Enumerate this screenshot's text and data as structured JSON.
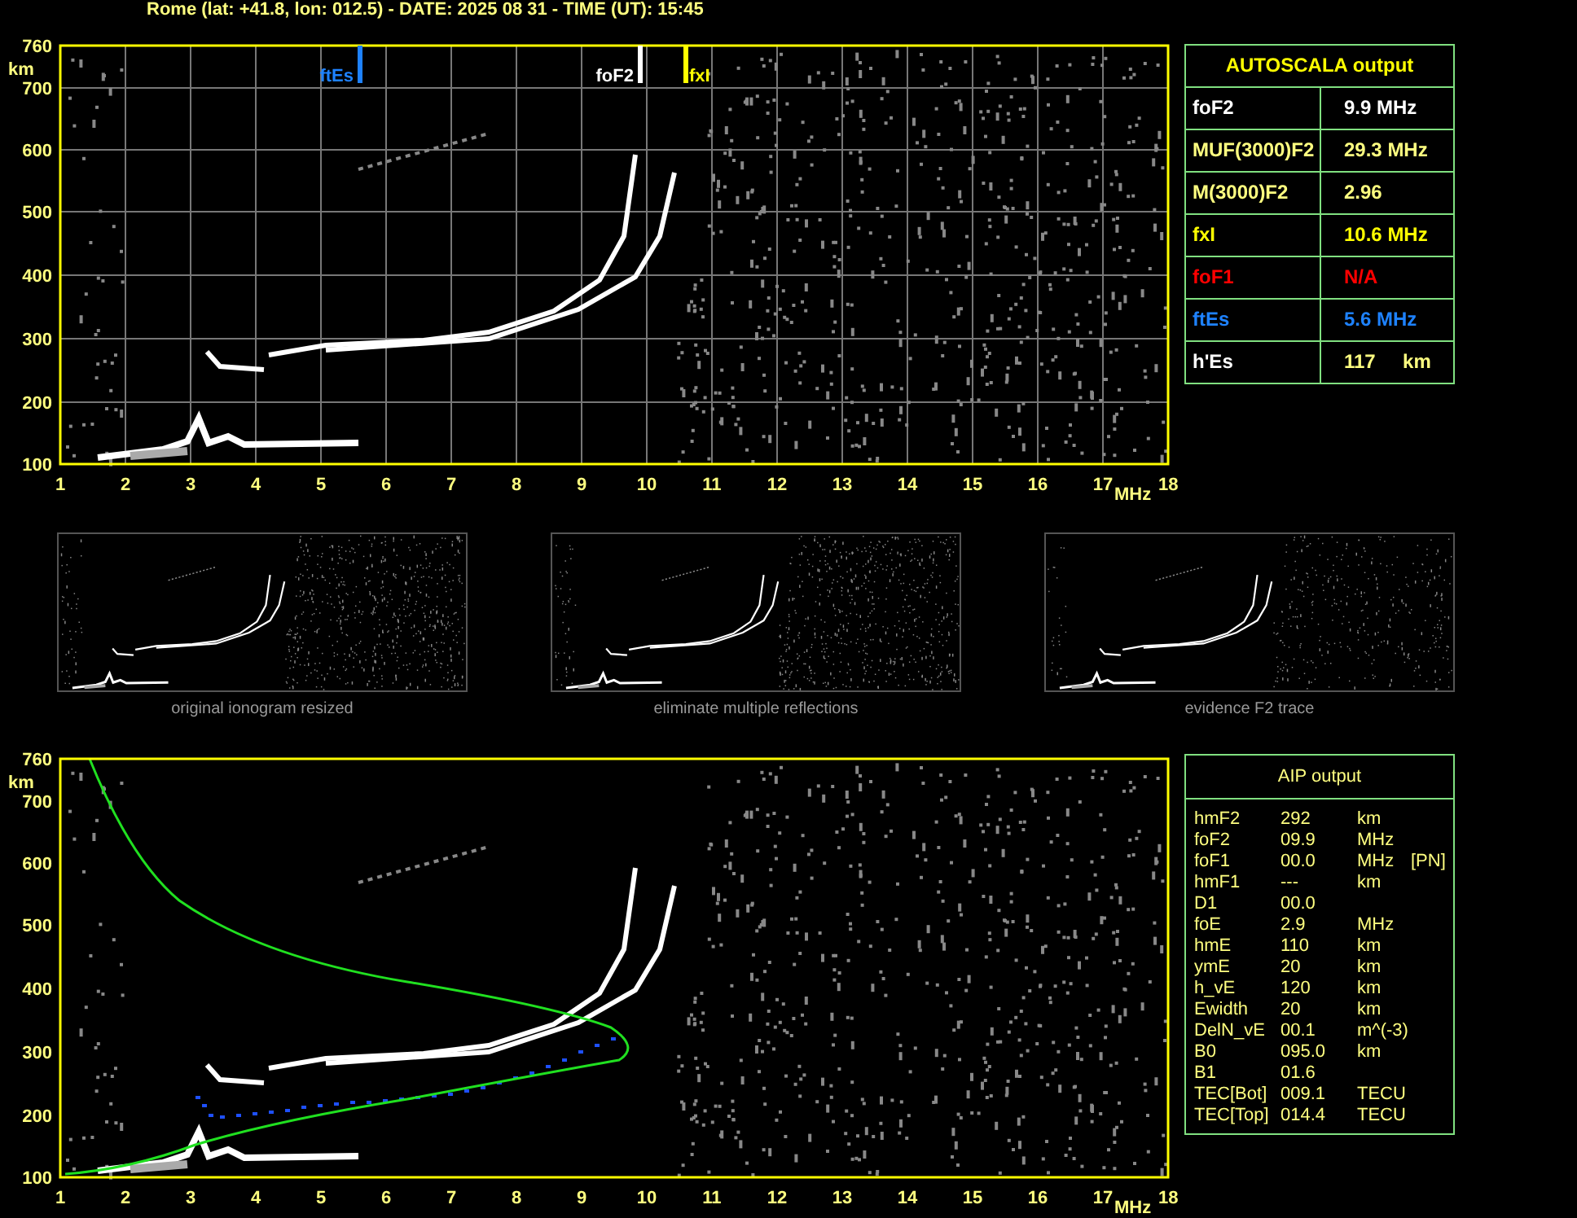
{
  "header": "Rome (lat: +41.8, lon: 012.5) - DATE: 2025 08 31 - TIME (UT): 15:45",
  "ionogram": {
    "y_unit": "km",
    "x_unit": "MHz",
    "y_ticks": [
      "760",
      "700",
      "600",
      "500",
      "400",
      "300",
      "200",
      "100"
    ],
    "x_ticks": [
      "1",
      "2",
      "3",
      "4",
      "5",
      "6",
      "7",
      "8",
      "9",
      "10",
      "11",
      "12",
      "13",
      "14",
      "15",
      "16",
      "17",
      "18"
    ],
    "markers": [
      {
        "label": "ftEs",
        "color": "#1e82ff"
      },
      {
        "label": "foF2",
        "color": "#ffffff"
      },
      {
        "label": "fxI",
        "color": "#ffff00"
      }
    ]
  },
  "autoscala": {
    "title": "AUTOSCALA output",
    "rows": [
      {
        "label": "foF2",
        "value": "9.9 MHz",
        "kind": "critical"
      },
      {
        "label": "MUF(3000)F2",
        "value": "29.3 MHz",
        "kind": "derived"
      },
      {
        "label": "M(3000)F2",
        "value": "2.96",
        "kind": "derived"
      },
      {
        "label": "fxI",
        "value": "10.6 MHz",
        "kind": "extraordinary"
      },
      {
        "label": "foF1",
        "value": "N/A",
        "kind": "missing"
      },
      {
        "label": "ftEs",
        "value": "5.6 MHz",
        "kind": "sporadic"
      },
      {
        "label": "h'Es",
        "value": "117     km",
        "kind": "height"
      }
    ]
  },
  "thumbnails": [
    {
      "caption": "original ionogram resized"
    },
    {
      "caption": "eliminate multiple reflections"
    },
    {
      "caption": "evidence F2 trace"
    }
  ],
  "aip_chart": {
    "y_unit": "km",
    "x_unit": "MHz",
    "y_ticks": [
      "760",
      "700",
      "600",
      "500",
      "400",
      "300",
      "200",
      "100"
    ],
    "x_ticks": [
      "1",
      "2",
      "3",
      "4",
      "5",
      "6",
      "7",
      "8",
      "9",
      "10",
      "11",
      "12",
      "13",
      "14",
      "15",
      "16",
      "17",
      "18"
    ]
  },
  "aip": {
    "title": "AIP output",
    "rows": [
      {
        "name": "hmF2",
        "value": "292",
        "unit": "km"
      },
      {
        "name": "foF2",
        "value": "09.9",
        "unit": "MHz"
      },
      {
        "name": "foF1",
        "value": "00.0",
        "unit": "MHz",
        "note": "[PN]"
      },
      {
        "name": "hmF1",
        "value": "---",
        "unit": "km"
      },
      {
        "name": "D1",
        "value": "00.0"
      },
      {
        "name": "foE",
        "value": "2.9",
        "unit": "MHz"
      },
      {
        "name": "hmE",
        "value": "110",
        "unit": "km"
      },
      {
        "name": "ymE",
        "value": "20",
        "unit": "km"
      },
      {
        "name": "h_vE",
        "value": "120",
        "unit": "km"
      },
      {
        "name": "Ewidth",
        "value": "20",
        "unit": "km"
      },
      {
        "name": "DelN_vE",
        "value": "00.1",
        "unit": "m^(-3)"
      },
      {
        "name": "B0",
        "value": "095.0",
        "unit": "km"
      },
      {
        "name": "B1",
        "value": "01.6"
      },
      {
        "name": "TEC[Bot]",
        "value": "009.1",
        "unit": "TECU"
      },
      {
        "name": "TEC[Top]",
        "value": "014.4",
        "unit": "TECU"
      }
    ]
  }
}
